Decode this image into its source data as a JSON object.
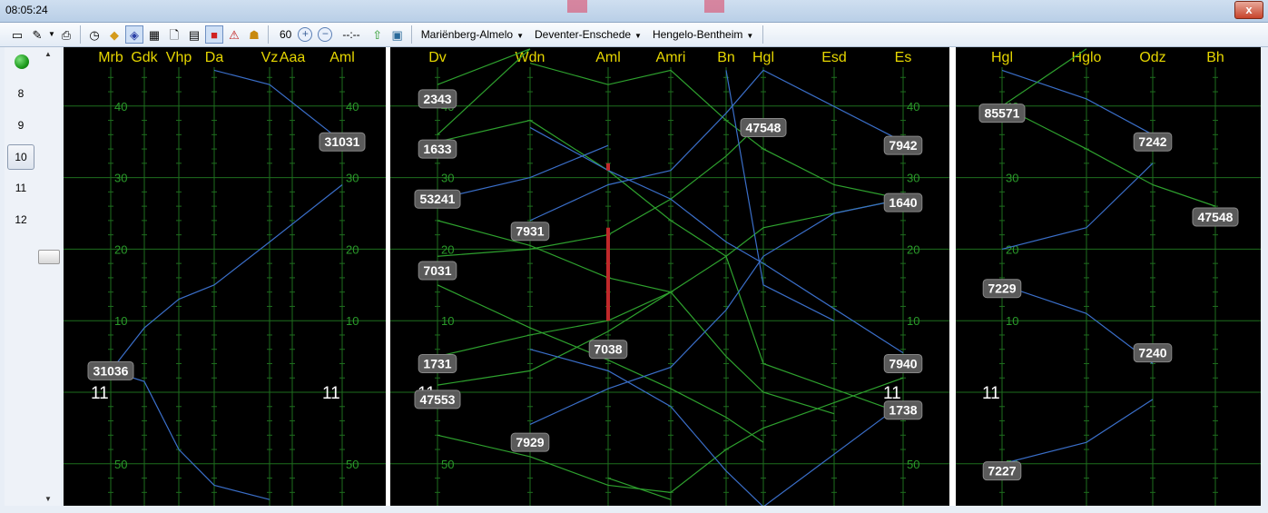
{
  "window": {
    "time": "08:05:24",
    "close_label": "x"
  },
  "toolbar": {
    "icons": [
      "windows-icon",
      "brush-icon",
      "print-icon",
      "clock-icon",
      "cube-icon",
      "diamond-icon",
      "grid-icon",
      "new-doc-icon",
      "page-icon",
      "record-icon",
      "warning-icon",
      "layers-icon"
    ],
    "speed": "60",
    "zoom_in_label": "+",
    "zoom_out_label": "−",
    "clock_placeholder": "--:--",
    "routes": [
      {
        "label": "Mariënberg-Almelo"
      },
      {
        "label": "Deventer-Enschede"
      },
      {
        "label": "Hengelo-Bentheim"
      }
    ]
  },
  "hours": [
    "8",
    "9",
    "10",
    "11",
    "12"
  ],
  "selected_hour": "10",
  "colors": {
    "background": "#000000",
    "station_label": "#e6d600",
    "grid": "#1e6e1e",
    "axis_label": "#2a9a2a",
    "train_blue": "#3a6ec8",
    "train_green": "#2ea12e",
    "conflict": "#c0282a",
    "badge_bg": "#5a5a5a",
    "badge_text": "#ffffff"
  },
  "panels": [
    {
      "id": "marienberg-almelo",
      "stations": [
        "Mrb",
        "Gdk",
        "Vhp",
        "Da",
        "Vz",
        "Aaa",
        "Aml"
      ],
      "station_x": [
        122,
        159,
        197,
        236,
        297,
        322,
        377
      ],
      "minute_axis_columns": [
        0,
        6
      ],
      "minute_labels": [
        {
          "label": "40",
          "minute": 40
        },
        {
          "label": "30",
          "minute": 30
        },
        {
          "label": "20",
          "minute": 20
        },
        {
          "label": "10",
          "minute": 10
        },
        {
          "label": "11",
          "minute": 0,
          "hour": true
        },
        {
          "label": "50",
          "minute": -10
        }
      ],
      "trains": [
        {
          "color": "blue",
          "points": [
            [
              0,
              3.0
            ],
            [
              1,
              1.5
            ],
            [
              2,
              -8.0
            ],
            [
              3,
              -13.0
            ],
            [
              4,
              -15.0
            ]
          ]
        },
        {
          "color": "blue",
          "points": [
            [
              0,
              3.0
            ],
            [
              1,
              9.0
            ],
            [
              2,
              13.0
            ],
            [
              3,
              15.0
            ],
            [
              4,
              21.0
            ],
            [
              6,
              29.0
            ]
          ]
        },
        {
          "color": "blue",
          "points": [
            [
              3,
              45.0
            ],
            [
              4,
              43.0
            ],
            [
              6,
              35.0
            ]
          ]
        }
      ],
      "badges": [
        {
          "text": "31036",
          "station": 0,
          "minute": 3.0
        },
        {
          "text": "31031",
          "station": 6,
          "minute": 35.0
        }
      ]
    },
    {
      "id": "deventer-enschede",
      "stations": [
        "Dv",
        "Wdn",
        "Aml",
        "Amri",
        "Bn",
        "Hgl",
        "Esd",
        "Es"
      ],
      "station_x": [
        482,
        584,
        670,
        739,
        800,
        841,
        919,
        995
      ],
      "minute_axis_columns": [
        0,
        7
      ],
      "minute_labels": [
        {
          "label": "40",
          "minute": 40
        },
        {
          "label": "30",
          "minute": 30
        },
        {
          "label": "20",
          "minute": 20
        },
        {
          "label": "10",
          "minute": 10
        },
        {
          "label": "11",
          "minute": 0,
          "hour": true
        },
        {
          "label": "50",
          "minute": -10
        }
      ],
      "trains": [
        {
          "color": "green",
          "points": [
            [
              0,
              43.0
            ],
            [
              1,
              48.0
            ]
          ]
        },
        {
          "color": "green",
          "points": [
            [
              0,
              35.0
            ],
            [
              1,
              38.0
            ],
            [
              2,
              31.0
            ],
            [
              3,
              24.0
            ],
            [
              4,
              19.0
            ],
            [
              5,
              4.0
            ],
            [
              7,
              -3.0
            ]
          ]
        },
        {
          "color": "green",
          "points": [
            [
              0,
              15.0
            ],
            [
              1,
              9.0
            ],
            [
              2,
              4.5
            ],
            [
              3,
              0.5
            ],
            [
              4,
              -3.5
            ],
            [
              5,
              -7.0
            ]
          ]
        },
        {
          "color": "green",
          "points": [
            [
              0,
              24.0
            ],
            [
              1,
              20.5
            ],
            [
              2,
              16.0
            ],
            [
              3,
              14.0
            ],
            [
              4,
              5.0
            ],
            [
              5,
              0.0
            ],
            [
              6,
              -3.0
            ]
          ]
        },
        {
          "color": "green",
          "points": [
            [
              0,
              19.0
            ],
            [
              1,
              20.0
            ],
            [
              2,
              22.0
            ],
            [
              3,
              27.0
            ],
            [
              4,
              33.0
            ],
            [
              5,
              38.0
            ]
          ]
        },
        {
          "color": "green",
          "points": [
            [
              0,
              5.0
            ],
            [
              1,
              8.0
            ],
            [
              2,
              10.0
            ],
            [
              3,
              14.0
            ]
          ]
        },
        {
          "color": "green",
          "points": [
            [
              0,
              1.0
            ],
            [
              1,
              3.0
            ],
            [
              2,
              8.5
            ],
            [
              3,
              14.0
            ],
            [
              4,
              19.0
            ],
            [
              5,
              23.0
            ],
            [
              7,
              27.0
            ]
          ]
        },
        {
          "color": "green",
          "points": [
            [
              0,
              -6.0
            ],
            [
              1,
              -9.0
            ],
            [
              2,
              -13.0
            ],
            [
              3,
              -14.0
            ],
            [
              4,
              -8.0
            ],
            [
              5,
              -5.0
            ],
            [
              7,
              2.0
            ]
          ]
        },
        {
          "color": "green",
          "points": [
            [
              1,
              46.0
            ],
            [
              2,
              43.0
            ],
            [
              3,
              45.0
            ],
            [
              4,
              38.0
            ],
            [
              5,
              34.0
            ],
            [
              6,
              29.0
            ],
            [
              7,
              27.0
            ]
          ]
        },
        {
          "color": "green",
          "points": [
            [
              0,
              36.0
            ],
            [
              1,
              48.0
            ]
          ]
        },
        {
          "color": "green",
          "points": [
            [
              2,
              -12.0
            ],
            [
              3,
              -15.0
            ]
          ]
        },
        {
          "color": "blue",
          "points": [
            [
              1,
              -4.5
            ],
            [
              2,
              0.5
            ],
            [
              3,
              3.5
            ],
            [
              4,
              11.5
            ],
            [
              5,
              19.0
            ],
            [
              6,
              25.0
            ],
            [
              7,
              27.0
            ]
          ]
        },
        {
          "color": "blue",
          "points": [
            [
              1,
              6.0
            ],
            [
              2,
              3.0
            ],
            [
              3,
              -2.0
            ],
            [
              4,
              -11.0
            ],
            [
              5,
              -16.0
            ],
            [
              7,
              -1.5
            ]
          ]
        },
        {
          "color": "blue",
          "points": [
            [
              1,
              24.0
            ],
            [
              2,
              29.0
            ],
            [
              3,
              31.0
            ],
            [
              4,
              39.0
            ],
            [
              5,
              45.0
            ],
            [
              7,
              35.0
            ]
          ]
        },
        {
          "color": "blue",
          "points": [
            [
              1,
              37.0
            ],
            [
              2,
              31.0
            ],
            [
              3,
              27.0
            ],
            [
              4,
              21.0
            ],
            [
              5,
              18.0
            ],
            [
              7,
              5.5
            ]
          ]
        },
        {
          "color": "blue",
          "points": [
            [
              0,
              27.0
            ],
            [
              1,
              30.0
            ],
            [
              2,
              34.5
            ]
          ]
        },
        {
          "color": "blue",
          "points": [
            [
              4,
              45.0
            ],
            [
              5,
              15.0
            ],
            [
              6,
              10.0
            ]
          ]
        }
      ],
      "conflicts": [
        {
          "station": 2,
          "from_minute": 31.0,
          "to_minute": 32.0
        },
        {
          "station": 2,
          "from_minute": 10.0,
          "to_minute": 23.0
        }
      ],
      "badges": [
        {
          "text": "2343",
          "station": 0,
          "minute": 41.0
        },
        {
          "text": "1633",
          "station": 0,
          "minute": 34.0
        },
        {
          "text": "53241",
          "station": 0,
          "minute": 27.0
        },
        {
          "text": "7931",
          "station": 1,
          "minute": 22.5
        },
        {
          "text": "7031",
          "station": 0,
          "minute": 17.0
        },
        {
          "text": "1731",
          "station": 0,
          "minute": 4.0
        },
        {
          "text": "47553",
          "station": 0,
          "minute": -1.0
        },
        {
          "text": "7929",
          "station": 1,
          "minute": -7.0
        },
        {
          "text": "7038",
          "station": 2,
          "minute": 6.0
        },
        {
          "text": "47548",
          "station": 5,
          "minute": 37.0
        },
        {
          "text": "7942",
          "station": 7,
          "minute": 34.5
        },
        {
          "text": "1640",
          "station": 7,
          "minute": 26.5
        },
        {
          "text": "7940",
          "station": 7,
          "minute": 4.0
        },
        {
          "text": "1738",
          "station": 7,
          "minute": -2.5
        }
      ]
    },
    {
      "id": "hengelo-bentheim",
      "stations": [
        "Hgl",
        "Hglo",
        "Odz",
        "Bh"
      ],
      "station_x": [
        1104,
        1197,
        1270,
        1339
      ],
      "minute_axis_columns": [
        0
      ],
      "minute_labels": [
        {
          "label": "40",
          "minute": 40
        },
        {
          "label": "30",
          "minute": 30
        },
        {
          "label": "20",
          "minute": 20
        },
        {
          "label": "10",
          "minute": 10
        },
        {
          "label": "11",
          "minute": 0,
          "hour": true
        },
        {
          "label": "50",
          "minute": -10
        }
      ],
      "trains": [
        {
          "color": "blue",
          "points": [
            [
              0,
              45.0
            ],
            [
              1,
              41.0
            ],
            [
              2,
              36.0
            ]
          ]
        },
        {
          "color": "blue",
          "points": [
            [
              0,
              20.0
            ],
            [
              1,
              23.0
            ],
            [
              2,
              32.0
            ]
          ]
        },
        {
          "color": "blue",
          "points": [
            [
              0,
              15.0
            ],
            [
              1,
              11.0
            ],
            [
              2,
              4.0
            ]
          ]
        },
        {
          "color": "blue",
          "points": [
            [
              0,
              -10.0
            ],
            [
              1,
              -7.0
            ],
            [
              2,
              -1.0
            ]
          ]
        },
        {
          "color": "green",
          "points": [
            [
              0,
              40.0
            ],
            [
              1,
              34.0
            ],
            [
              2,
              29.0
            ],
            [
              3,
              26.0
            ]
          ]
        },
        {
          "color": "green",
          "points": [
            [
              0,
              40.0
            ],
            [
              1,
              48.0
            ]
          ]
        }
      ],
      "badges": [
        {
          "text": "85571",
          "station": 0,
          "minute": 39.0
        },
        {
          "text": "7242",
          "station": 2,
          "minute": 35.0
        },
        {
          "text": "47548",
          "station": 3,
          "minute": 24.5
        },
        {
          "text": "7229",
          "station": 0,
          "minute": 14.5
        },
        {
          "text": "7240",
          "station": 2,
          "minute": 5.5
        },
        {
          "text": "7227",
          "station": 0,
          "minute": -11.0
        }
      ]
    }
  ]
}
